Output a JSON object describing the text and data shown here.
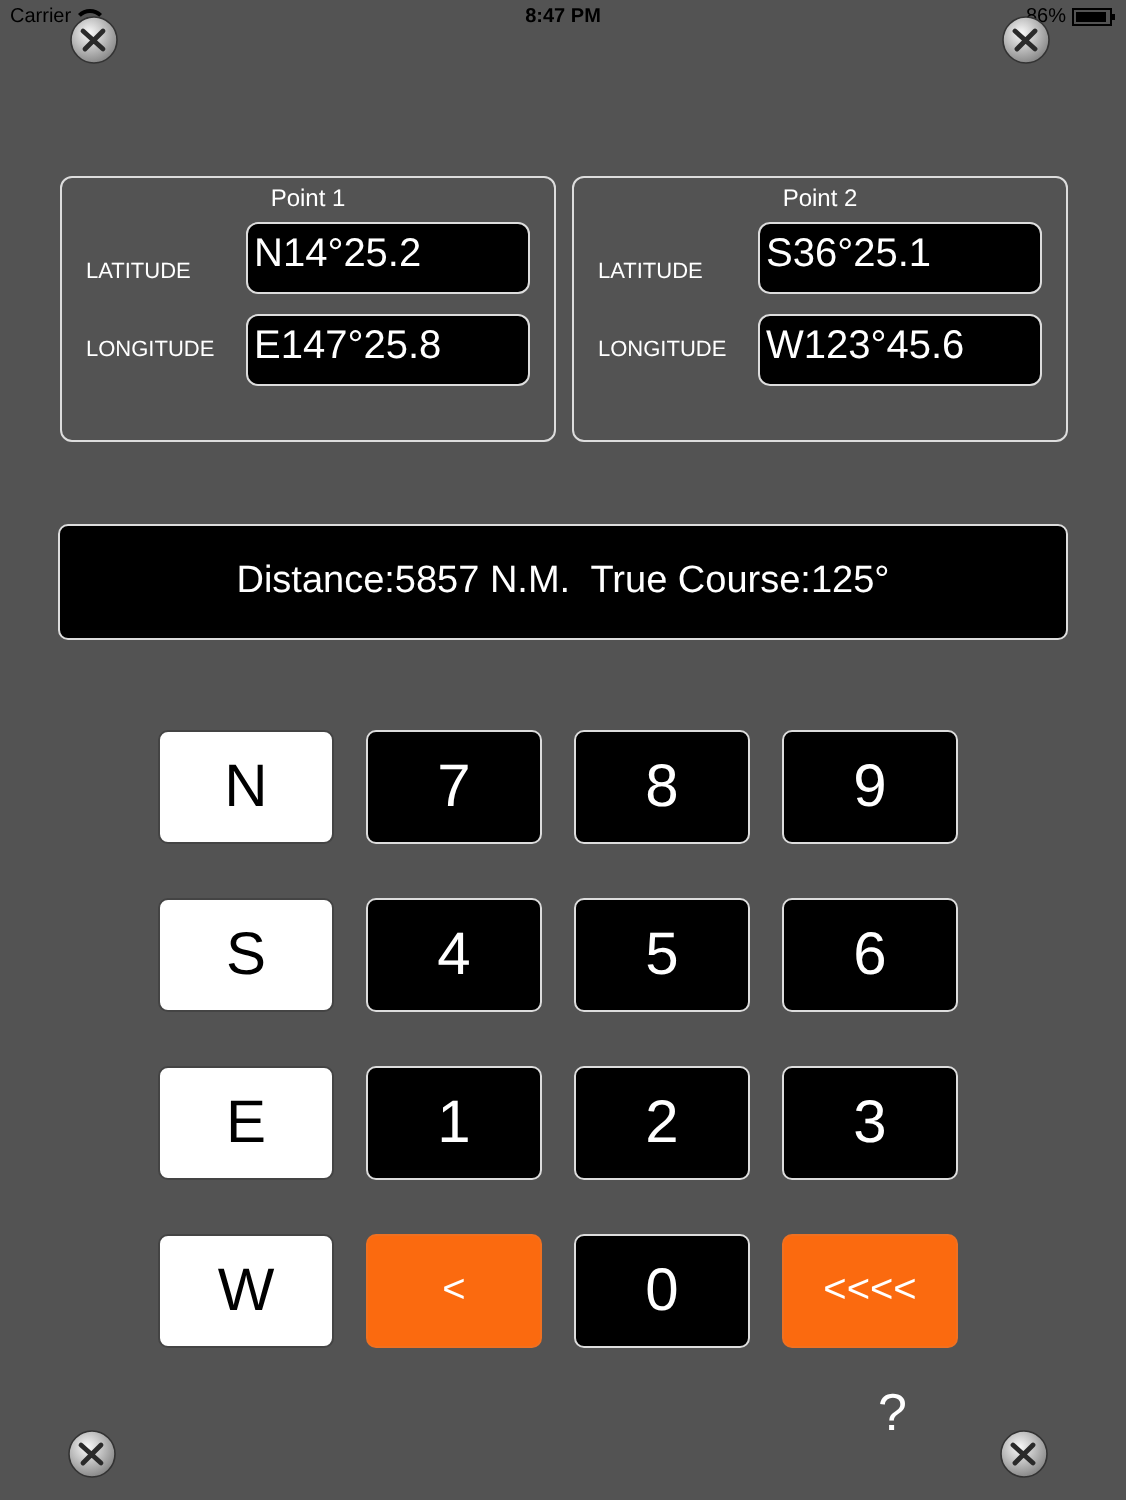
{
  "status_bar": {
    "carrier": "Carrier",
    "time": "8:47 PM",
    "battery": "86%"
  },
  "points": [
    {
      "title": "Point 1",
      "fields": [
        {
          "label": "LATITUDE",
          "value": "N14°25.2"
        },
        {
          "label": "LONGITUDE",
          "value": "E147°25.8"
        }
      ]
    },
    {
      "title": "Point 2",
      "fields": [
        {
          "label": "LATITUDE",
          "value": "S36°25.1"
        },
        {
          "label": "LONGITUDE",
          "value": "W123°45.6"
        }
      ]
    }
  ],
  "result": "Distance:5857 N.M.  True Course:125°",
  "keypad": [
    {
      "label": "N",
      "kind": "letter"
    },
    {
      "label": "7",
      "kind": "digit"
    },
    {
      "label": "8",
      "kind": "digit"
    },
    {
      "label": "9",
      "kind": "digit"
    },
    {
      "label": "S",
      "kind": "letter"
    },
    {
      "label": "4",
      "kind": "digit"
    },
    {
      "label": "5",
      "kind": "digit"
    },
    {
      "label": "6",
      "kind": "digit"
    },
    {
      "label": "E",
      "kind": "letter"
    },
    {
      "label": "1",
      "kind": "digit"
    },
    {
      "label": "2",
      "kind": "digit"
    },
    {
      "label": "3",
      "kind": "digit"
    },
    {
      "label": "W",
      "kind": "letter"
    },
    {
      "label": "<",
      "kind": "action"
    },
    {
      "label": "0",
      "kind": "digit"
    },
    {
      "label": "<<<<",
      "kind": "action"
    }
  ],
  "help": "?"
}
